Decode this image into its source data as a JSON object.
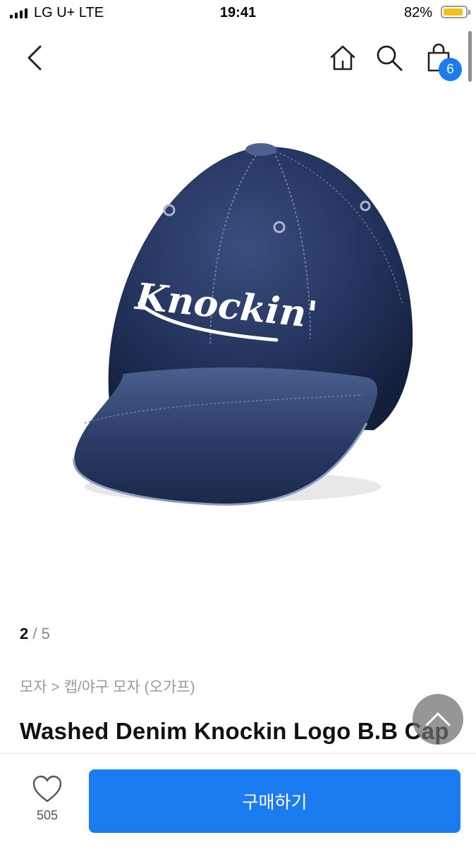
{
  "status_bar": {
    "carrier": "LG U+  LTE",
    "time": "19:41",
    "battery_percent": "82%",
    "battery_level": 0.82,
    "icons": [
      "signal-icon",
      "battery-icon"
    ]
  },
  "nav": {
    "icons": [
      "back-icon",
      "home-icon",
      "search-icon",
      "shopping-bag-icon"
    ],
    "cart_count": "6",
    "badge_color": "#1a7cf0"
  },
  "product": {
    "image_subject": "denim-baseball-cap",
    "image_logo_text": "Knockin'",
    "image_counter": {
      "current": "2",
      "separator": " / ",
      "total": "5"
    },
    "breadcrumb": "모자 > 캡/야구 모자 (오가프)",
    "title": "Washed Denim Knockin Logo B.B Cap"
  },
  "bottom_bar": {
    "like_icon": "heart-icon",
    "like_count": "505",
    "buy_label": "구매하기",
    "buy_color": "#1a7cf0"
  },
  "scroll_top_icon": "chevron-up-icon"
}
